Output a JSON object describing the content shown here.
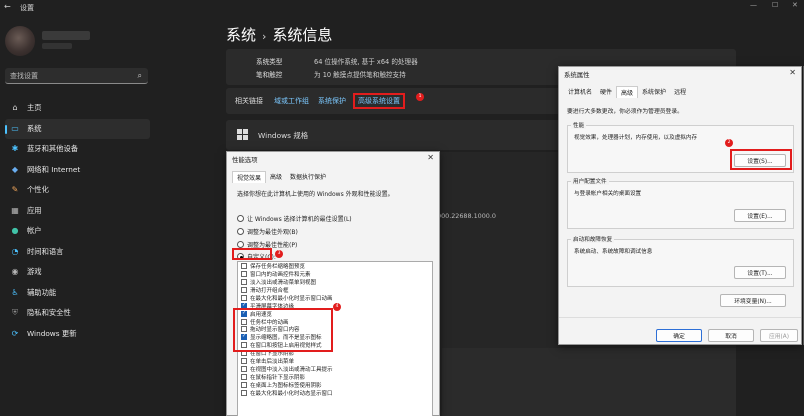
{
  "window": {
    "title": "设置",
    "back_glyph": "←",
    "minimize": "—",
    "maximize": "☐",
    "close": "✕"
  },
  "search": {
    "placeholder": "查找设置"
  },
  "sidebar": {
    "items": [
      {
        "label": "主页",
        "icon": "home-icon",
        "glyph": "⌂",
        "color": "#d9d9d9"
      },
      {
        "label": "系统",
        "icon": "monitor-icon",
        "glyph": "▭",
        "color": "#4cc2ff"
      },
      {
        "label": "蓝牙和其他设备",
        "icon": "bluetooth-icon",
        "glyph": "✱",
        "color": "#4cc2ff"
      },
      {
        "label": "网络和 Internet",
        "icon": "network-icon",
        "glyph": "◆",
        "color": "#6aaef0"
      },
      {
        "label": "个性化",
        "icon": "brush-icon",
        "glyph": "✎",
        "color": "#f0a65b"
      },
      {
        "label": "应用",
        "icon": "apps-icon",
        "glyph": "▦",
        "color": "#b5b5b5"
      },
      {
        "label": "帐户",
        "icon": "account-icon",
        "glyph": "●",
        "color": "#41c3a8"
      },
      {
        "label": "时间和语言",
        "icon": "clock-globe-icon",
        "glyph": "◔",
        "color": "#4cc2ff"
      },
      {
        "label": "游戏",
        "icon": "gamepad-icon",
        "glyph": "◉",
        "color": "#b5b5b5"
      },
      {
        "label": "辅助功能",
        "icon": "accessibility-icon",
        "glyph": "♿",
        "color": "#4cc2ff"
      },
      {
        "label": "隐私和安全性",
        "icon": "shield-icon",
        "glyph": "⛨",
        "color": "#8a8a8a"
      },
      {
        "label": "Windows 更新",
        "icon": "update-icon",
        "glyph": "⟳",
        "color": "#4cc2ff"
      }
    ]
  },
  "header": {
    "crumb_parent": "系统",
    "crumb_sep": "›",
    "crumb_current": "系统信息"
  },
  "specs": [
    {
      "k": "系统类型",
      "v": "64 位操作系统, 基于 x64 的处理器"
    },
    {
      "k": "笔和触控",
      "v": "为 10 触摸点提供笔和触控支持"
    }
  ],
  "related": {
    "label": "相关链接",
    "links": [
      "域或工作组",
      "系统保护"
    ],
    "highlight": "高级系统设置",
    "badge": "1"
  },
  "windows_spec": "Windows 规格",
  "bg_version": "000.22688.1000.0",
  "perf": {
    "title": "性能选项",
    "close": "✕",
    "tabs": [
      "视觉效果",
      "高级",
      "数据执行保护"
    ],
    "desc": "选择你想在此计算机上使用的 Windows 外观和性能设置。",
    "radios": [
      {
        "label": "让 Windows 选择计算机的最佳设置(L)",
        "on": false
      },
      {
        "label": "调整为最佳外观(B)",
        "on": false
      },
      {
        "label": "调整为最佳性能(P)",
        "on": false
      },
      {
        "label": "自定义(C):",
        "on": true
      }
    ],
    "radio_badge": "3",
    "list_badge": "4",
    "checks": [
      {
        "label": "保存任务栏缩略图预览",
        "on": false
      },
      {
        "label": "窗口内的动画控件和元素",
        "on": false
      },
      {
        "label": "淡入淡出或滑动菜单到视图",
        "on": false
      },
      {
        "label": "滑动打开组合框",
        "on": false
      },
      {
        "label": "在最大化和最小化时显示窗口动画",
        "on": false
      },
      {
        "label": "平滑屏幕字体边缘",
        "on": true
      },
      {
        "label": "启用速览",
        "on": true
      },
      {
        "label": "任务栏中的动画",
        "on": false
      },
      {
        "label": "拖动时显示窗口内容",
        "on": false
      },
      {
        "label": "显示缩略图，而不是显示图标",
        "on": true
      },
      {
        "label": "在窗口和按钮上启用视觉样式",
        "on": false
      },
      {
        "label": "在窗口下显示阴影",
        "on": false
      },
      {
        "label": "在单击后淡出菜单",
        "on": false
      },
      {
        "label": "在视图中淡入淡出或滑动工具提示",
        "on": false
      },
      {
        "label": "在鼠标指针下显示阴影",
        "on": false
      },
      {
        "label": "在桌面上为图标标签使用阴影",
        "on": false
      },
      {
        "label": "在最大化和最小化时动态显示窗口",
        "on": false
      }
    ]
  },
  "sysprop": {
    "title": "系统属性",
    "close": "✕",
    "tabs": [
      "计算机名",
      "硬件",
      "高级",
      "系统保护",
      "远程"
    ],
    "admin_note": "要进行大多数更改，你必须作为管理员登录。",
    "perf_group": {
      "label": "性能",
      "text": "视觉效果，处理器计划，内存使用，以及虚拟内存",
      "button": "设置(S)...",
      "badge": "2"
    },
    "profile_group": {
      "label": "用户配置文件",
      "text": "与登录帐户相关的桌面设置",
      "button": "设置(E)..."
    },
    "startup_group": {
      "label": "启动和故障恢复",
      "text": "系统启动、系统故障和调试信息",
      "button": "设置(T)..."
    },
    "env_button": "环境变量(N)...",
    "ok": "确定",
    "cancel": "取消",
    "apply": "应用(A)"
  }
}
